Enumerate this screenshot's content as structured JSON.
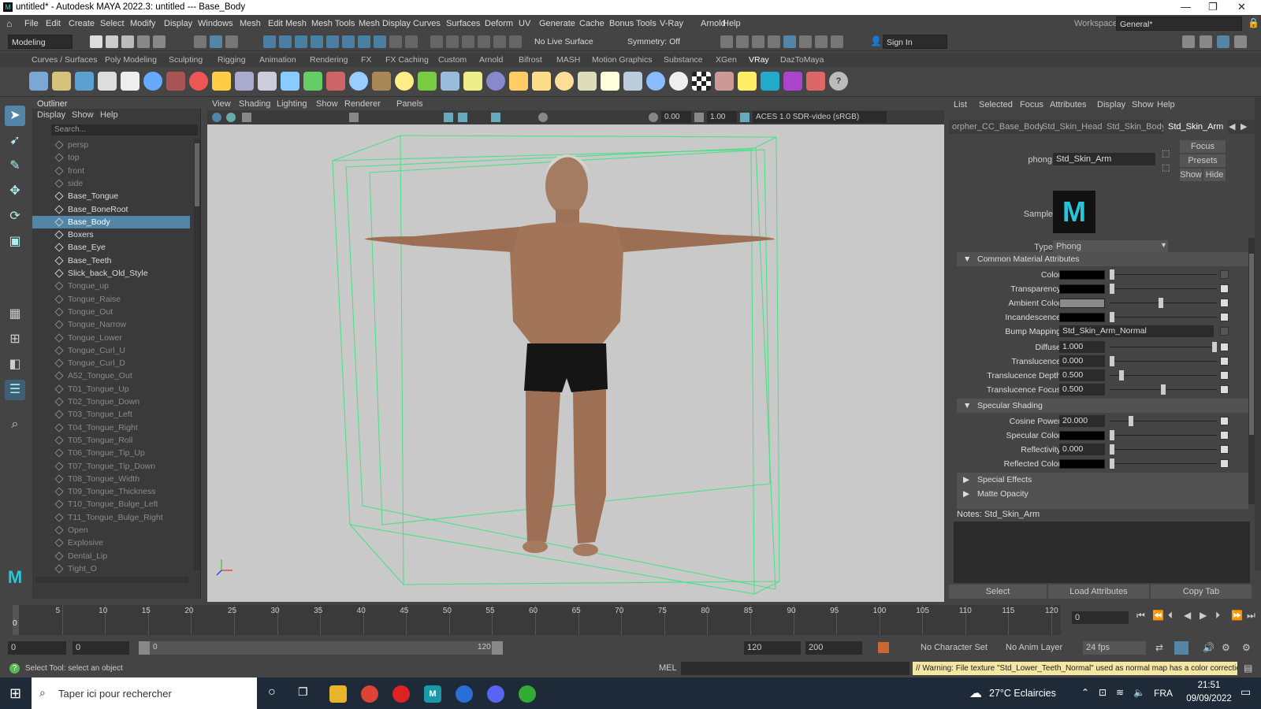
{
  "window": {
    "title": "untitled* - Autodesk MAYA 2022.3: untitled   ---   Base_Body"
  },
  "menu": [
    "File",
    "Edit",
    "Create",
    "Select",
    "Modify",
    "Display",
    "Windows",
    "Mesh",
    "Edit Mesh",
    "Mesh Tools",
    "Mesh Display",
    "Curves",
    "Surfaces",
    "Deform",
    "UV",
    "Generate",
    "Cache",
    "Bonus Tools",
    "V-Ray",
    "Arnold",
    "Help"
  ],
  "workspace": {
    "label": "Workspace:",
    "value": "General*"
  },
  "statusline": {
    "mode": "Modeling",
    "live_surface": "No Live Surface",
    "symmetry": "Symmetry: Off",
    "signin": "Sign In"
  },
  "shelf_tabs": [
    "Curves / Surfaces",
    "Poly Modeling",
    "Sculpting",
    "Rigging",
    "Animation",
    "Rendering",
    "FX",
    "FX Caching",
    "Custom",
    "Arnold",
    "Bifrost",
    "MASH",
    "Motion Graphics",
    "Substance",
    "XGen",
    "VRay",
    "DazToMaya"
  ],
  "outliner": {
    "title": "Outliner",
    "menu": [
      "Display",
      "Show",
      "Help"
    ],
    "search_placeholder": "Search...",
    "items": [
      {
        "label": "persp",
        "dim": true
      },
      {
        "label": "top",
        "dim": true
      },
      {
        "label": "front",
        "dim": true
      },
      {
        "label": "side",
        "dim": true
      },
      {
        "label": "Base_Tongue",
        "dim": false
      },
      {
        "label": "Base_BoneRoot",
        "dim": false
      },
      {
        "label": "Base_Body",
        "dim": false,
        "selected": true
      },
      {
        "label": "Boxers",
        "dim": false
      },
      {
        "label": "Base_Eye",
        "dim": false
      },
      {
        "label": "Base_Teeth",
        "dim": false
      },
      {
        "label": "Slick_back_Old_Style",
        "dim": false
      },
      {
        "label": "Tongue_up",
        "dim": true
      },
      {
        "label": "Tongue_Raise",
        "dim": true
      },
      {
        "label": "Tongue_Out",
        "dim": true
      },
      {
        "label": "Tongue_Narrow",
        "dim": true
      },
      {
        "label": "Tongue_Lower",
        "dim": true
      },
      {
        "label": "Tongue_Curl_U",
        "dim": true
      },
      {
        "label": "Tongue_Curl_D",
        "dim": true
      },
      {
        "label": "A52_Tongue_Out",
        "dim": true
      },
      {
        "label": "T01_Tongue_Up",
        "dim": true
      },
      {
        "label": "T02_Tongue_Down",
        "dim": true
      },
      {
        "label": "T03_Tongue_Left",
        "dim": true
      },
      {
        "label": "T04_Tongue_Right",
        "dim": true
      },
      {
        "label": "T05_Tongue_Roll",
        "dim": true
      },
      {
        "label": "T06_Tongue_Tip_Up",
        "dim": true
      },
      {
        "label": "T07_Tongue_Tip_Down",
        "dim": true
      },
      {
        "label": "T08_Tongue_Width",
        "dim": true
      },
      {
        "label": "T09_Tongue_Thickness",
        "dim": true
      },
      {
        "label": "T10_Tongue_Bulge_Left",
        "dim": true
      },
      {
        "label": "T11_Tongue_Bulge_Right",
        "dim": true
      },
      {
        "label": "Open",
        "dim": true
      },
      {
        "label": "Explosive",
        "dim": true
      },
      {
        "label": "Dental_Lip",
        "dim": true
      },
      {
        "label": "Tight_O",
        "dim": true
      }
    ]
  },
  "viewport": {
    "menu": [
      "View",
      "Shading",
      "Lighting",
      "Show",
      "Renderer",
      "Panels"
    ],
    "field1": "0.00",
    "field2": "1.00",
    "colorspace": "ACES 1.0 SDR-video (sRGB)"
  },
  "attr_editor": {
    "menu": [
      "List",
      "Selected",
      "Focus",
      "Attributes",
      "Display",
      "Show",
      "Help"
    ],
    "tabs": [
      "orpher_CC_Base_Body",
      "Std_Skin_Head",
      "Std_Skin_Body",
      "Std_Skin_Arm"
    ],
    "node_label": "phong:",
    "node_value": "Std_Skin_Arm",
    "focus": "Focus",
    "presets": "Presets",
    "show": "Show",
    "hide": "Hide",
    "sample": "Sample",
    "type_label": "Type",
    "type_value": "Phong",
    "sec_common": "Common Material Attributes",
    "color": "Color",
    "transparency": "Transparency",
    "ambient": "Ambient Color",
    "incandescence": "Incandescence",
    "bump": "Bump Mapping",
    "bump_value": "Std_Skin_Arm_Normal",
    "diffuse": "Diffuse",
    "diffuse_value": "1.000",
    "diffuse_level": 1.0,
    "translucence": "Translucence",
    "translucence_value": "0.000",
    "translucence_level": 0.0,
    "trans_depth": "Translucence Depth",
    "trans_depth_value": "0.500",
    "trans_focus": "Translucence Focus",
    "trans_focus_value": "0.500",
    "trans_focus_level": 0.5,
    "sec_spec": "Specular Shading",
    "cosine": "Cosine Power",
    "cosine_value": "20.000",
    "spec_color": "Specular Color",
    "reflectivity": "Reflectivity",
    "reflectivity_value": "0.000",
    "reflectivity_level": 0.0,
    "reflected": "Reflected Color",
    "sec_special": "Special Effects",
    "sec_matte": "Matte Opacity",
    "notes": "Notes:  Std_Skin_Arm",
    "btn_select": "Select",
    "btn_load": "Load Attributes",
    "btn_copy": "Copy Tab"
  },
  "timeline": {
    "ticks": [
      "5",
      "10",
      "15",
      "20",
      "25",
      "30",
      "35",
      "40",
      "45",
      "50",
      "55",
      "60",
      "65",
      "70",
      "75",
      "80",
      "85",
      "90",
      "95",
      "100",
      "105",
      "110",
      "115",
      "120"
    ],
    "current": "0",
    "frame_field": "0"
  },
  "range": {
    "start": "0",
    "start2": "0",
    "slider_start": "0",
    "slider_end": "120",
    "end": "120",
    "end2": "200",
    "character": "No Character Set",
    "anim_layer": "No Anim Layer",
    "fps": "24 fps"
  },
  "cmd": {
    "help": "Select Tool: select an object",
    "lang": "MEL",
    "warning": "// Warning: File texture \"Std_Lower_Teeth_Normal\" used as normal map has a color correction en"
  },
  "taskbar": {
    "search": "Taper ici pour rechercher",
    "weather": "27°C  Eclaircies",
    "lang": "FRA",
    "time": "21:51",
    "date": "09/09/2022"
  },
  "colors": {
    "accent": "#5285a6",
    "bbox": "#4ddf88",
    "viewport_bg": "#c9c9c9"
  }
}
